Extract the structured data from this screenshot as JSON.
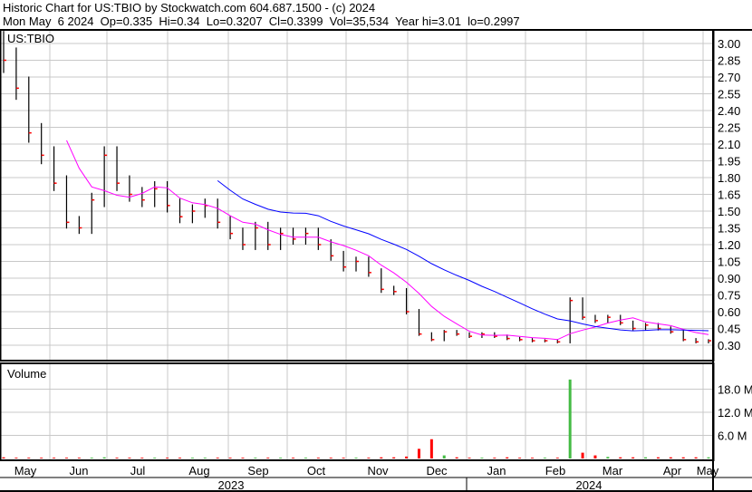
{
  "header": {
    "line1": "Historic Chart for US:TBIO by Stockwatch.com 604.687.1500 - (c) 2024",
    "line2": "Mon May  6 2024  Op=0.335  Hi=0.34  Lo=0.3207  Cl=0.3399  Vol=35,534  Year hi=3.01  lo=0.2997"
  },
  "chart_data": {
    "type": "bar",
    "title": "US:TBIO",
    "volume_label": "Volume",
    "price_ticks": [
      "3.00",
      "2.85",
      "2.70",
      "2.55",
      "2.40",
      "2.25",
      "2.10",
      "1.95",
      "1.80",
      "1.65",
      "1.50",
      "1.35",
      "1.20",
      "1.05",
      "0.90",
      "0.75",
      "0.60",
      "0.45",
      "0.30"
    ],
    "price_range": [
      0.3,
      3.0
    ],
    "volume_ticks": [
      "18.0 M",
      "12.0 M",
      "6.0 M"
    ],
    "months": [
      "May",
      "Jun",
      "Jul",
      "Aug",
      "Sep",
      "Oct",
      "Nov",
      "Dec",
      "Jan",
      "Feb",
      "Mar",
      "Apr",
      "May"
    ],
    "years": [
      "2023",
      "2024"
    ],
    "weekly_close": [
      2.85,
      2.6,
      2.2,
      2.0,
      1.75,
      1.4,
      1.35,
      1.6,
      2.0,
      1.75,
      1.65,
      1.6,
      1.7,
      1.55,
      1.45,
      1.5,
      1.55,
      1.4,
      1.3,
      1.2,
      1.35,
      1.2,
      1.3,
      1.25,
      1.3,
      1.2,
      1.1,
      1.0,
      1.05,
      0.95,
      0.8,
      0.78,
      0.6,
      0.4,
      0.35,
      0.42,
      0.4,
      0.38,
      0.4,
      0.38,
      0.36,
      0.35,
      0.34,
      0.34,
      0.33,
      0.7,
      0.55,
      0.52,
      0.55,
      0.5,
      0.45,
      0.48,
      0.45,
      0.42,
      0.35,
      0.33,
      0.34
    ],
    "weekly_volume_m": [
      0.3,
      0.2,
      0.2,
      0.2,
      0.2,
      0.2,
      0.2,
      0.2,
      0.3,
      0.2,
      0.2,
      0.2,
      0.2,
      0.2,
      0.2,
      0.2,
      0.2,
      0.2,
      0.2,
      0.2,
      0.2,
      0.2,
      0.2,
      0.2,
      0.2,
      0.2,
      0.2,
      0.2,
      0.2,
      0.2,
      0.3,
      0.3,
      0.5,
      2.5,
      5.0,
      0.8,
      0.3,
      0.2,
      0.2,
      0.2,
      0.3,
      0.2,
      0.2,
      0.2,
      0.2,
      20.5,
      1.5,
      0.8,
      0.4,
      0.3,
      0.3,
      0.3,
      0.3,
      0.3,
      0.3,
      0.3,
      0.3
    ],
    "ma_short_color": "#ff00ff",
    "ma_long_color": "#0000ff",
    "up_color": "#009900",
    "down_color": "#ff0000",
    "volume_up_color": "#44bb44"
  }
}
